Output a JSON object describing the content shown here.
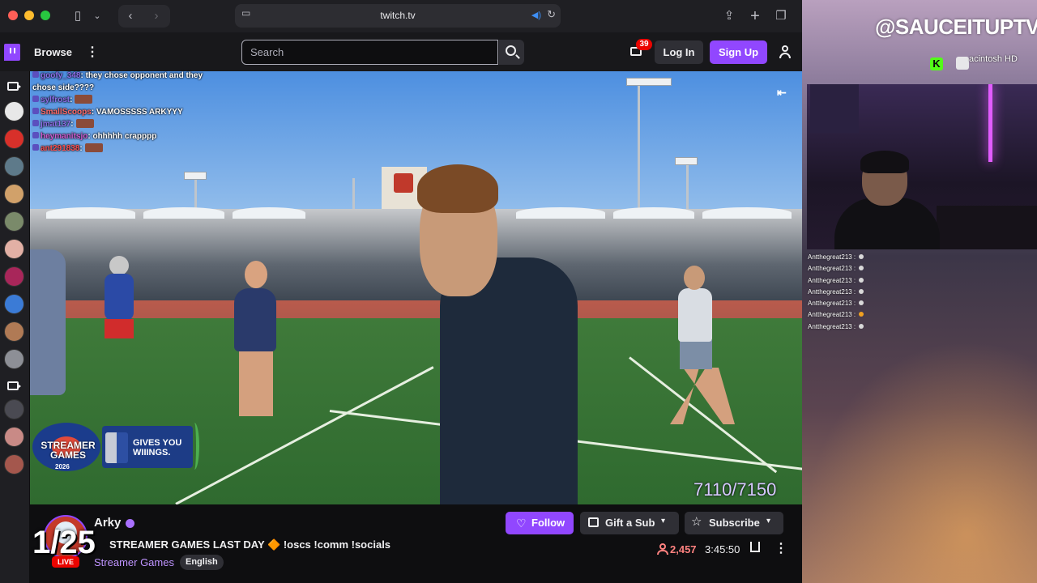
{
  "browser": {
    "url": "twitch.tv"
  },
  "nav": {
    "browse_label": "Browse",
    "search_placeholder": "Search",
    "notification_count": "39",
    "login_label": "Log In",
    "signup_label": "Sign Up"
  },
  "video": {
    "counter": "7110/7150",
    "chat": [
      {
        "user": "goofy_348",
        "message": "they chose opponent and they chose side????"
      },
      {
        "user": "sylfrost",
        "message": ""
      },
      {
        "user": "SmallScoops",
        "message": "VAMOSSSSS ARKYYY"
      },
      {
        "user": "jmat137",
        "message": ""
      },
      {
        "user": "heymanitsjo",
        "message": "ohhhhh crapppp"
      },
      {
        "user": "ant291838",
        "message": ""
      }
    ],
    "sponsor": {
      "title": "STREAMER GAMES",
      "year": "2026",
      "tagline": "GIVES YOU WIIINGS."
    }
  },
  "channel": {
    "name": "Arky",
    "live_label": "LIVE",
    "day_overlay": "1/25",
    "stream_title": "STREAMER GAMES LAST DAY 🔶 !oscs !comm !socials",
    "category": "Streamer Games",
    "language": "English",
    "follow_label": "Follow",
    "gift_label": "Gift a Sub",
    "subscribe_label": "Subscribe",
    "viewers": "2,457",
    "uptime": "3:45:50"
  },
  "desktop": {
    "handle": "@SAUCEITUPTV",
    "drive_label": "acintosh HD",
    "side_chat": [
      {
        "user": "Antthegreat213 :"
      },
      {
        "user": "Antthegreat213 :"
      },
      {
        "user": "Antthegreat213 :"
      },
      {
        "user": "Antthegreat213 :"
      },
      {
        "user": "Antthegreat213 :"
      },
      {
        "user": "Antthegreat213 :"
      },
      {
        "user": "Antthegreat213 :"
      }
    ]
  },
  "colors": {
    "twitch_purple": "#9147ff",
    "live_red": "#eb0400",
    "viewer_red": "#ff8280"
  }
}
